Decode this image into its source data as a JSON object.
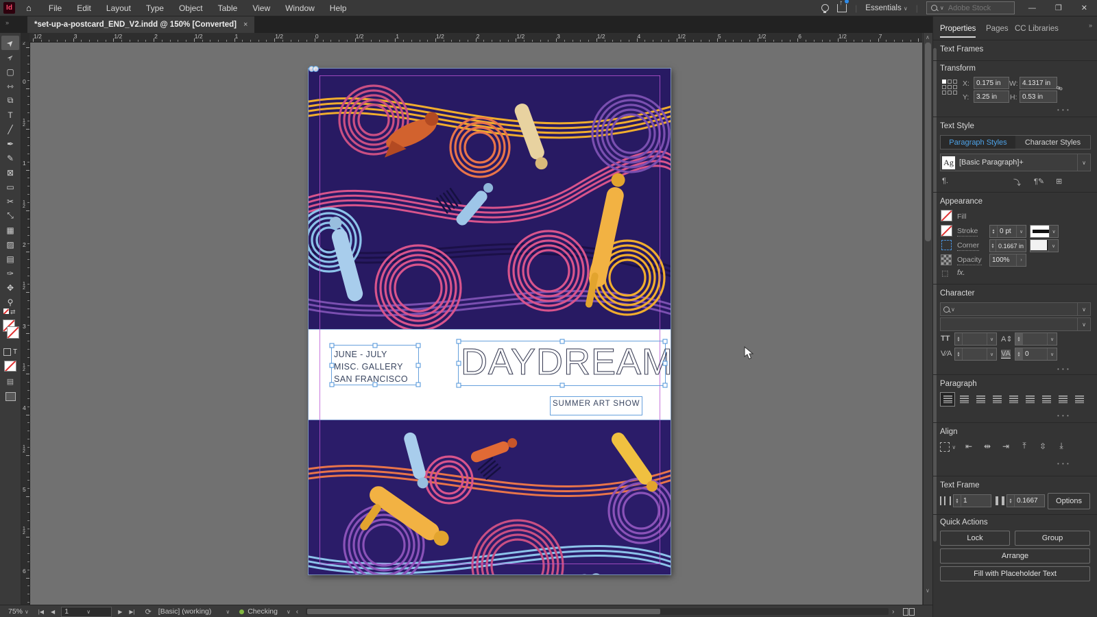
{
  "app": {
    "logo": "Id",
    "menus": [
      "File",
      "Edit",
      "Layout",
      "Type",
      "Object",
      "Table",
      "View",
      "Window",
      "Help"
    ],
    "workspace_label": "Essentials",
    "search_placeholder": "Adobe Stock",
    "window_controls": [
      "—",
      "❐",
      "✕"
    ]
  },
  "tab": {
    "title": "*set-up-a-postcard_END_V2.indd @ 150% [Converted]",
    "close": "×"
  },
  "toolbar": {
    "tools": [
      {
        "name": "selection",
        "glyph": "➤"
      },
      {
        "name": "direct-selection",
        "glyph": "➣"
      },
      {
        "name": "page",
        "glyph": "▢"
      },
      {
        "name": "gap",
        "glyph": "⇿"
      },
      {
        "name": "content-collector",
        "glyph": "⧉"
      },
      {
        "name": "type",
        "glyph": "T"
      },
      {
        "name": "line",
        "glyph": "╱"
      },
      {
        "name": "pen",
        "glyph": "✒"
      },
      {
        "name": "pencil",
        "glyph": "✎"
      },
      {
        "name": "frame",
        "glyph": "⊠"
      },
      {
        "name": "rectangle",
        "glyph": "▭"
      },
      {
        "name": "scissors",
        "glyph": "✂"
      },
      {
        "name": "free-transform",
        "glyph": "⤡"
      },
      {
        "name": "gradient-swatch",
        "glyph": "▦"
      },
      {
        "name": "gradient-feather",
        "glyph": "▨"
      },
      {
        "name": "note",
        "glyph": "▤"
      },
      {
        "name": "eyedropper",
        "glyph": "✑"
      },
      {
        "name": "hand",
        "glyph": "✥"
      },
      {
        "name": "zoom",
        "glyph": "⚲"
      }
    ],
    "formatting_affects_text": "T"
  },
  "rulers": {
    "horizontal": [
      "1/2",
      "3",
      "1/2",
      "2",
      "1/2",
      "1",
      "1/2",
      "0",
      "1/2",
      "1",
      "1/2",
      "2",
      "1/2",
      "3",
      "1/2",
      "4",
      "1/2",
      "5",
      "1/2",
      "6",
      "1/2",
      "7"
    ],
    "vertical": [
      "1/2",
      "0",
      "1/2",
      "1",
      "1/2",
      "2",
      "1/2",
      "3",
      "1/2",
      "4",
      "1/2",
      "5",
      "1/2",
      "6"
    ]
  },
  "document": {
    "info_lines": [
      "JUNE - JULY",
      "MISC. GALLERY",
      "SAN FRANCISCO"
    ],
    "title": "DAYDREAM",
    "subtitle": "SUMMER ART SHOW"
  },
  "panel": {
    "tabs": [
      "Properties",
      "Pages",
      "CC Libraries"
    ],
    "selection_label": "Text Frames",
    "transform": {
      "title": "Transform",
      "x_label": "X:",
      "x": "0.175 in",
      "y_label": "Y:",
      "y": "3.25 in",
      "w_label": "W:",
      "w": "4.1317 in",
      "h_label": "H:",
      "h": "0.53 in"
    },
    "text_style": {
      "title": "Text Style",
      "tab_paragraph": "Paragraph Styles",
      "tab_character": "Character Styles",
      "ag_glyph": "Ag",
      "style_name": "[Basic Paragraph]+",
      "pilcrow": "¶."
    },
    "appearance": {
      "title": "Appearance",
      "fill_label": "Fill",
      "stroke_label": "Stroke",
      "stroke_value": "0 pt",
      "corner_label": "Corner",
      "corner_value": "0.1667 in",
      "opacity_label": "Opacity",
      "opacity_value": "100%",
      "fx_label": "fx."
    },
    "character": {
      "title": "Character",
      "font_size_icon": "TT",
      "leading_icon": "A⇕",
      "kerning_icon": "V⁄A",
      "tracking_icon": "VA",
      "tracking_value": "0"
    },
    "paragraph": {
      "title": "Paragraph",
      "buttons": [
        "align-left",
        "align-center",
        "align-right",
        "justify-left",
        "justify-center",
        "justify-right",
        "justify-all",
        "align-toward-spine",
        "align-away-from-spine"
      ]
    },
    "align": {
      "title": "Align",
      "buttons": [
        {
          "name": "align-left-edges",
          "glyph": "⇤"
        },
        {
          "name": "align-horizontal-centers",
          "glyph": "⇹"
        },
        {
          "name": "align-right-edges",
          "glyph": "⇥"
        },
        {
          "name": "align-top-edges",
          "glyph": "⤒"
        },
        {
          "name": "align-vertical-centers",
          "glyph": "⇳"
        },
        {
          "name": "align-bottom-edges",
          "glyph": "⤓"
        }
      ]
    },
    "text_frame": {
      "title": "Text Frame",
      "columns": "1",
      "gutter": "0.1667",
      "options_label": "Options"
    },
    "quick_actions": {
      "title": "Quick Actions",
      "buttons": [
        "Lock",
        "Group",
        "Arrange",
        "Fill with Placeholder Text"
      ]
    }
  },
  "statusbar": {
    "zoom_level": "75%",
    "nav": [
      "|◀",
      "◀",
      "▶",
      "▶|"
    ],
    "page_number": "1",
    "preset": "[Basic] (working)",
    "preflight_status": "Checking"
  },
  "colors": {
    "accent_blue": "#4ea3e8",
    "selection_blue": "#66a0dc",
    "guide_violet": "#ba55d3",
    "preflight_green": "#83b841",
    "artwork_background": "#281a63",
    "text_navy": "#3a4660"
  }
}
